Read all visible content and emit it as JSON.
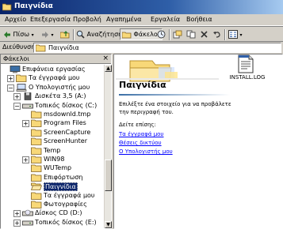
{
  "window": {
    "title": "Παιγνίδια"
  },
  "menu": {
    "items": [
      "Αρχείο",
      "Επεξεργασία",
      "Προβολή",
      "Αγαπημένα",
      "Εργαλεία",
      "Βοήθεια"
    ]
  },
  "toolbar": {
    "back_label": "Πίσω",
    "search_label": "Αναζήτηση",
    "folders_label": "Φάκελοι"
  },
  "address": {
    "label": "Διεύθυνση",
    "value": "Παιγνίδια"
  },
  "folders_pane": {
    "header": "Φάκελοι",
    "close_glyph": "×",
    "tree": [
      {
        "label": "Επιφάνεια εργασίας",
        "expander": "",
        "icon": "desktop"
      },
      {
        "label": "Τα έγγραφά μου",
        "expander": "+",
        "icon": "folder"
      },
      {
        "label": "Ο Υπολογιστής μου",
        "expander": "−",
        "icon": "computer"
      },
      {
        "label": "Δισκέτα 3,5 (A:)",
        "expander": "+",
        "icon": "floppy"
      },
      {
        "label": "Τοπικός δίσκος (C:)",
        "expander": "−",
        "icon": "drive"
      },
      {
        "label": "msdownld.tmp",
        "expander": "",
        "icon": "folder"
      },
      {
        "label": "Program Files",
        "expander": "+",
        "icon": "folder"
      },
      {
        "label": "ScreenCapture",
        "expander": "",
        "icon": "folder"
      },
      {
        "label": "ScreenHunter",
        "expander": "",
        "icon": "folder"
      },
      {
        "label": "Temp",
        "expander": "",
        "icon": "folder"
      },
      {
        "label": "WIN98",
        "expander": "+",
        "icon": "folder"
      },
      {
        "label": "WUTemp",
        "expander": "",
        "icon": "folder"
      },
      {
        "label": "Επιφόρτωση",
        "expander": "",
        "icon": "folder"
      },
      {
        "label": "Παιγνίδια",
        "expander": "",
        "icon": "folder-open",
        "selected": true
      },
      {
        "label": "Τα έγγραφά μου",
        "expander": "",
        "icon": "folder"
      },
      {
        "label": "Φωτογραφίες",
        "expander": "",
        "icon": "folder"
      },
      {
        "label": "Δίσκος CD (D:)",
        "expander": "+",
        "icon": "cdrom"
      },
      {
        "label": "Τοπικός δίσκος (E:)",
        "expander": "+",
        "icon": "drive"
      }
    ]
  },
  "content": {
    "title": "Παιγνίδια",
    "instruction": "Επιλέξτε ένα στοιχείο για να προβάλετε την περιγραφή του.",
    "see_also": "Δείτε επίσης:",
    "links": [
      "Τα έγγραφά μου",
      "Θέσεις δικτύου",
      "Ο Υπολογιστής μου"
    ],
    "files": [
      {
        "name": "INSTALL.LOG",
        "icon": "text-file-icon"
      }
    ]
  },
  "colors": {
    "titlebar": "#0a246a",
    "selection": "#0a246a",
    "link": "#0000ff",
    "face": "#d4d0c8"
  }
}
